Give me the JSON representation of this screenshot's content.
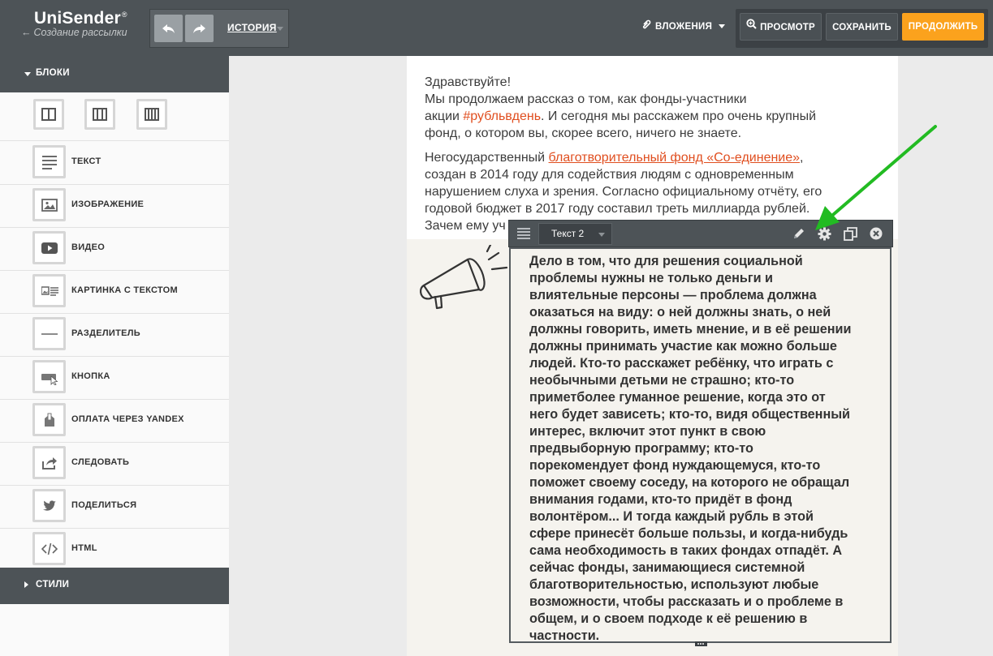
{
  "header": {
    "logo": "UniSender",
    "logo_reg": "®",
    "back_arrow": "←",
    "subtitle": "Создание рассылки",
    "history_label": "ИСТОРИЯ",
    "attachments_label": "ВЛОЖЕНИЯ",
    "preview_label": "ПРОСМОТР",
    "save_label": "СОХРАНИТЬ",
    "continue_label": "ПРОДОЛЖИТЬ"
  },
  "sidebar": {
    "blocks_title": "БЛОКИ",
    "styles_title": "СТИЛИ",
    "layout_columns": [
      2,
      3,
      4
    ],
    "items": [
      {
        "label": "ТЕКСТ",
        "icon": "text-icon"
      },
      {
        "label": "ИЗОБРАЖЕНИЕ",
        "icon": "image-icon"
      },
      {
        "label": "ВИДЕО",
        "icon": "video-icon"
      },
      {
        "label": "КАРТИНКА С ТЕКСТОМ",
        "icon": "image-with-text-icon"
      },
      {
        "label": "РАЗДЕЛИТЕЛЬ",
        "icon": "divider-icon"
      },
      {
        "label": "КНОПКА",
        "icon": "button-icon"
      },
      {
        "label": "ОПЛАТА ЧЕРЕЗ YANDEX",
        "icon": "yandex-payment-icon"
      },
      {
        "label": "СЛЕДОВАТЬ",
        "icon": "follow-icon"
      },
      {
        "label": "ПОДЕЛИТЬСЯ",
        "icon": "share-icon"
      },
      {
        "label": "HTML",
        "icon": "html-icon"
      }
    ]
  },
  "email": {
    "p1_greeting": "Здравствуйте!",
    "p1_line2": "Мы продолжаем рассказ о том, как фонды-участники",
    "p1_line3_pre": "акции ",
    "p1_hashtag": "#рубльвдень",
    "p1_line3_post": ". И сегодня мы расскажем про очень крупный",
    "p1_line4": "фонд, о котором вы, скорее всего, ничего не знаете.",
    "p2_pre": "Негосударственный ",
    "p2_link": "благотворительный фонд «Со-единение»",
    "p2_post": ",",
    "p2_line2": "создан в 2014 году для содействия людям с одновременным",
    "p2_line3": "нарушением слуха и зрения. Согласно официальному отчёту, его",
    "p2_line4": "годовой бюджет в 2017 году составил треть миллиарда рублей.",
    "p2_line5": "Зачем ему уч"
  },
  "editor": {
    "block_name": "Текст 2",
    "lines": [
      "Дело в том, что для решения социальной",
      "проблемы нужны не только деньги и",
      "влиятельные персоны — проблема должна",
      "оказаться на виду: о ней должны знать, о ней",
      "должны говорить, иметь мнение, и в её решении",
      "должны принимать участие как можно больше",
      "людей. Кто-то расскажет ребёнку, что играть с",
      "необычными детьми не страшно; кто-то",
      "приметболее гуманное решение, когда это от",
      "него будет зависеть; кто-то, видя общественный",
      "интерес, включит этот пункт в свою",
      "предвыборную программу; кто-то",
      "порекомендует фонд нуждающемуся, кто-то",
      "поможет своему соседу, на которого не обращал",
      "внимания годами, кто-то придёт в фонд",
      "волонтёром... И тогда каждый рубль в этой",
      "сфере принесёт больше пользы, и когда-нибудь",
      "сама необходимость в таких фондах отпадёт. А",
      "сейчас фонды, занимающиеся системной",
      "благотворительностью, используют любые",
      "возможности, чтобы рассказать и о проблеме в",
      "общем, и о своем подходе к её решению в",
      "частности."
    ]
  },
  "colors": {
    "topbar": "#4d5357",
    "accent_orange": "#fba21d",
    "link_red": "#e04e1f",
    "annotation_arrow": "#22bb22"
  }
}
